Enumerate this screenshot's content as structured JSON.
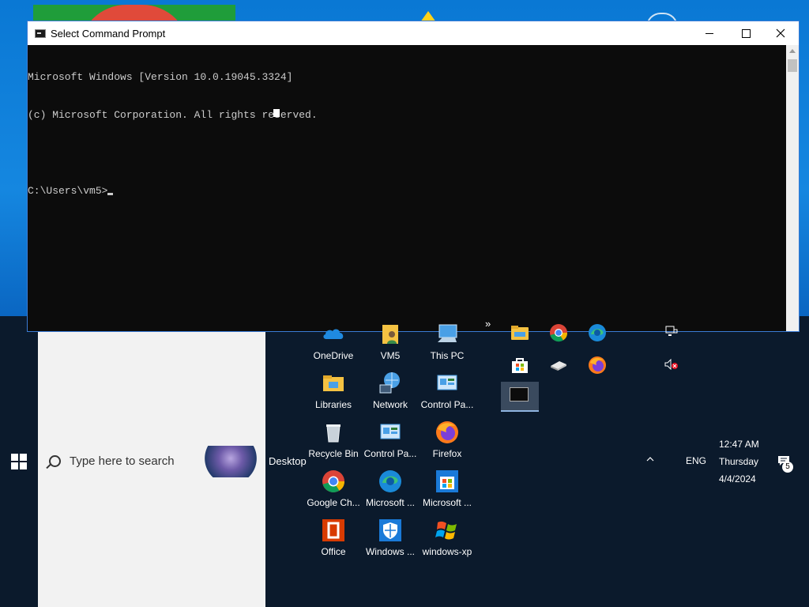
{
  "cmd_window": {
    "title": "Select Command Prompt",
    "lines": [
      "Microsoft Windows [Version 10.0.19045.3324]",
      "(c) Microsoft Corporation. All rights reserved.",
      "",
      "C:\\Users\\vm5>"
    ]
  },
  "taskbar": {
    "search_placeholder": "Type here to search",
    "desktop_toolbar_label": "Desktop",
    "overflow_chevron": "»",
    "language": "ENG",
    "clock": {
      "time": "12:47 AM",
      "day": "Thursday",
      "date": "4/4/2024"
    },
    "notification_count": "5"
  },
  "desktop_items": [
    {
      "label": "OneDrive",
      "icon": "onedrive-icon"
    },
    {
      "label": "VM5",
      "icon": "user-folder-icon"
    },
    {
      "label": "This PC",
      "icon": "this-pc-icon"
    },
    {
      "label": "Libraries",
      "icon": "libraries-icon"
    },
    {
      "label": "Network",
      "icon": "network-icon"
    },
    {
      "label": "Control Pa...",
      "icon": "control-panel-icon"
    },
    {
      "label": "Recycle Bin",
      "icon": "recycle-bin-icon"
    },
    {
      "label": "Control Pa...",
      "icon": "control-panel-icon"
    },
    {
      "label": "Firefox",
      "icon": "firefox-icon"
    },
    {
      "label": "Google Ch...",
      "icon": "chrome-icon"
    },
    {
      "label": "Microsoft ...",
      "icon": "edge-icon"
    },
    {
      "label": "Microsoft ...",
      "icon": "store-icon"
    },
    {
      "label": "Office",
      "icon": "office-icon"
    },
    {
      "label": "Windows ...",
      "icon": "windows-security-icon"
    },
    {
      "label": "windows-xp",
      "icon": "windows-xp-icon"
    }
  ],
  "colors": {
    "taskbar": "#0b1a2c",
    "console_bg": "#0c0c0c",
    "console_text": "#cccccc",
    "accent": "#0a78d4"
  }
}
